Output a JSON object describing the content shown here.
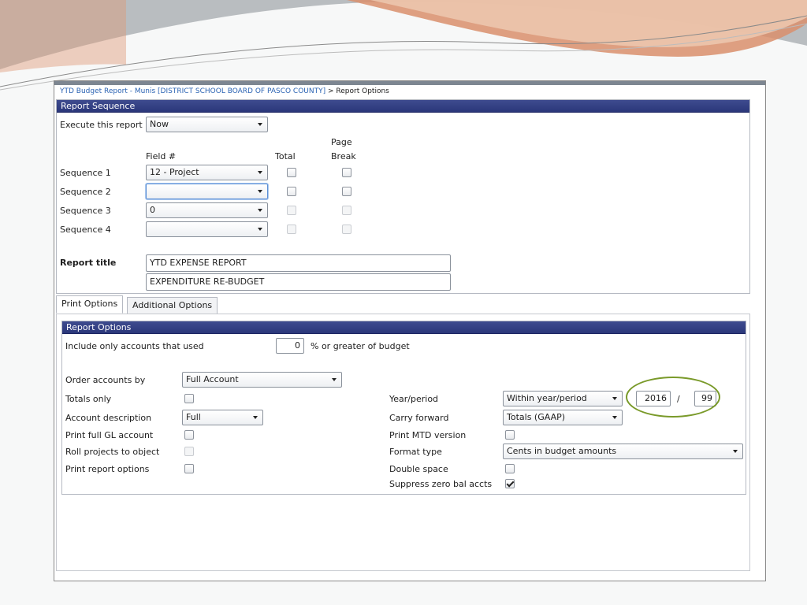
{
  "breadcrumb": {
    "link": "YTD Budget Report - Munis [DISTRICT SCHOOL BOARD OF PASCO COUNTY]",
    "separator": ">",
    "current": "Report Options"
  },
  "report_sequence": {
    "header": "Report Sequence",
    "execute_label": "Execute this report",
    "execute_value": "Now",
    "col_field": "Field #",
    "col_total": "Total",
    "col_page": "Page",
    "col_break": "Break",
    "sequences": [
      {
        "label": "Sequence 1",
        "value": "12 - Project",
        "total": false,
        "page_break": false
      },
      {
        "label": "Sequence 2",
        "value": "",
        "total": false,
        "page_break": false
      },
      {
        "label": "Sequence 3",
        "value": "0",
        "total": false,
        "page_break": false
      },
      {
        "label": "Sequence 4",
        "value": "",
        "total": false,
        "page_break": false
      }
    ],
    "title_label": "Report title",
    "title_line1": "YTD EXPENSE REPORT",
    "title_line2": "EXPENDITURE RE-BUDGET"
  },
  "tabs": [
    {
      "label": "Print Options",
      "active": true
    },
    {
      "label": "Additional Options",
      "active": false
    }
  ],
  "report_options": {
    "header": "Report Options",
    "include_label": "Include only accounts that used",
    "include_value": "0",
    "include_suffix": "% or greater of budget",
    "order_label": "Order accounts by",
    "order_value": "Full Account",
    "totals_only_label": "Totals only",
    "account_desc_label": "Account description",
    "account_desc_value": "Full",
    "print_full_gl_label": "Print full GL account",
    "roll_projects_label": "Roll projects to object",
    "print_report_options_label": "Print report options",
    "year_period_label": "Year/period",
    "year_period_value": "Within year/period",
    "year_value": "2016",
    "period_separator": "/",
    "period_value": "99",
    "carry_forward_label": "Carry forward",
    "carry_forward_value": "Totals (GAAP)",
    "print_mtd_label": "Print MTD version",
    "format_type_label": "Format type",
    "format_type_value": "Cents in budget amounts",
    "double_space_label": "Double space",
    "suppress_zero_label": "Suppress zero bal accts",
    "suppress_zero_checked": true
  },
  "colors": {
    "panel_header": "#2f3b80",
    "highlight": "#7a9a2a",
    "link": "#2b63b3"
  }
}
